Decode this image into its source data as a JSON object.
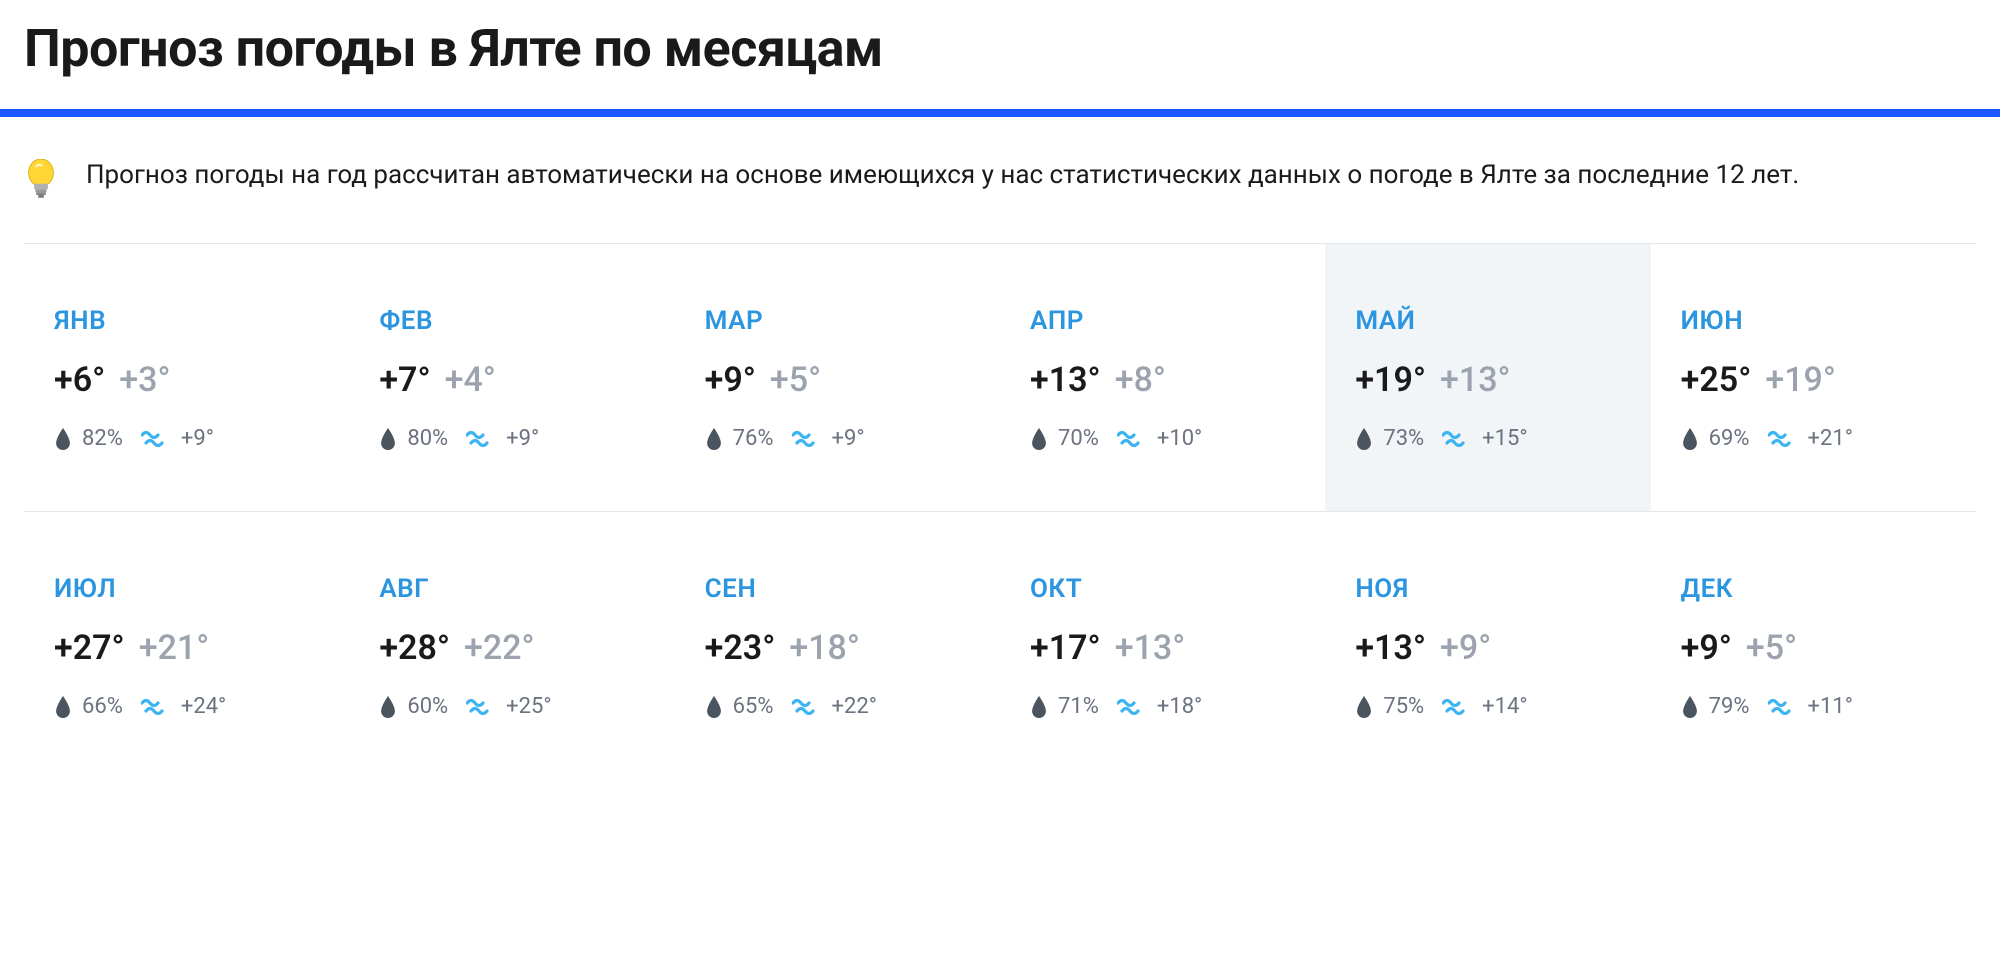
{
  "page_title": "Прогноз погоды в Ялте по месяцам",
  "info_text": "Прогноз погоды на год рассчитан автоматически на основе имеющихся у нас статистических данных о погоде в Ялте за последние 12 лет.",
  "months": [
    {
      "name": "ЯНВ",
      "high": "+6°",
      "low": "+3°",
      "humidity": "82%",
      "water": "+9°",
      "highlighted": false
    },
    {
      "name": "ФЕВ",
      "high": "+7°",
      "low": "+4°",
      "humidity": "80%",
      "water": "+9°",
      "highlighted": false
    },
    {
      "name": "МАР",
      "high": "+9°",
      "low": "+5°",
      "humidity": "76%",
      "water": "+9°",
      "highlighted": false
    },
    {
      "name": "АПР",
      "high": "+13°",
      "low": "+8°",
      "humidity": "70%",
      "water": "+10°",
      "highlighted": false
    },
    {
      "name": "МАЙ",
      "high": "+19°",
      "low": "+13°",
      "humidity": "73%",
      "water": "+15°",
      "highlighted": true
    },
    {
      "name": "ИЮН",
      "high": "+25°",
      "low": "+19°",
      "humidity": "69%",
      "water": "+21°",
      "highlighted": false
    },
    {
      "name": "ИЮЛ",
      "high": "+27°",
      "low": "+21°",
      "humidity": "66%",
      "water": "+24°",
      "highlighted": false
    },
    {
      "name": "АВГ",
      "high": "+28°",
      "low": "+22°",
      "humidity": "60%",
      "water": "+25°",
      "highlighted": false
    },
    {
      "name": "СЕН",
      "high": "+23°",
      "low": "+18°",
      "humidity": "65%",
      "water": "+22°",
      "highlighted": false
    },
    {
      "name": "ОКТ",
      "high": "+17°",
      "low": "+13°",
      "humidity": "71%",
      "water": "+18°",
      "highlighted": false
    },
    {
      "name": "НОЯ",
      "high": "+13°",
      "low": "+9°",
      "humidity": "75%",
      "water": "+14°",
      "highlighted": false
    },
    {
      "name": "ДЕК",
      "high": "+9°",
      "low": "+5°",
      "humidity": "79%",
      "water": "+11°",
      "highlighted": false
    }
  ]
}
